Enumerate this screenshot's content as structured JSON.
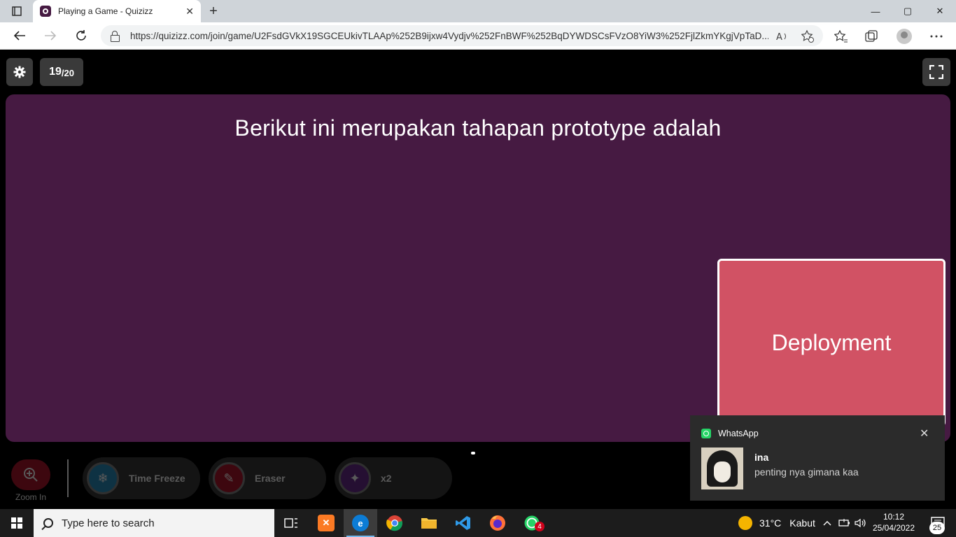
{
  "browser": {
    "tab_title": "Playing a Game - Quizizz",
    "tab_close": "✕",
    "new_tab": "+",
    "url": "https://quizizz.com/join/game/U2FsdGVkX19SGCEUkivTLAAp%252B9ijxw4Vydjv%252FnBWF%252BqDYWDSCsFVzO8YiW3%252FjlZkmYKgjVpTaD...",
    "window_controls": [
      "—",
      "▢",
      "✕"
    ]
  },
  "quiz": {
    "current": "19",
    "total": "/20",
    "question": "Berikut ini merupakan tahapan prototype adalah",
    "option": "Deployment",
    "zoom_label": "Zoom In",
    "powerups": [
      {
        "label": "Time Freeze",
        "icon": "time-freeze-icon",
        "color": "#2a8fbf"
      },
      {
        "label": "Eraser",
        "icon": "eraser-icon",
        "color": "#b0152c"
      },
      {
        "label": "x2",
        "icon": "double-points-icon",
        "color": "#6a2b8f"
      }
    ],
    "colors": {
      "card": "#461a42",
      "option": "#d15264"
    }
  },
  "toast": {
    "app": "WhatsApp",
    "sender": "ina",
    "message": "penting nya gimana kaa",
    "close": "✕"
  },
  "taskbar": {
    "search_placeholder": "Type here to search",
    "weather_temp": "31°C",
    "weather_cond": "Kabut",
    "time": "10:12",
    "date": "25/04/2022",
    "whatsapp_badge": "4",
    "notification_count": "25"
  }
}
